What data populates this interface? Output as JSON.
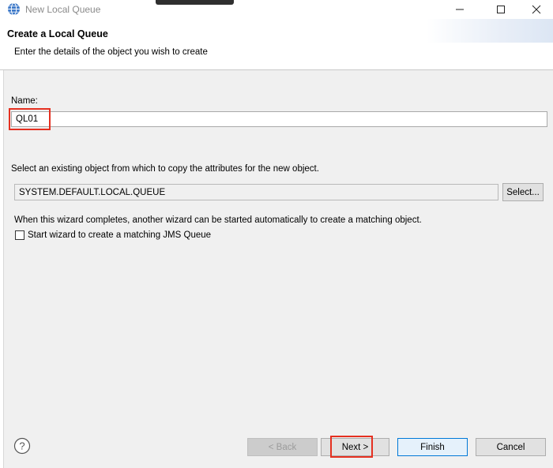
{
  "window": {
    "title": "New Local Queue",
    "icons": {
      "app": "globe-icon",
      "minimize": "minimize-icon",
      "maximize": "maximize-icon",
      "close": "close-icon"
    }
  },
  "header": {
    "title": "Create a Local Queue",
    "description": "Enter the details of the object you wish to create"
  },
  "form": {
    "name_label": "Name:",
    "name_value": "QL01",
    "copy_label": "Select an existing object from which to copy the attributes for the new object.",
    "copy_value": "SYSTEM.DEFAULT.LOCAL.QUEUE",
    "select_label": "Select...",
    "wizard_note": "When this wizard completes, another wizard can be started automatically to create a matching object.",
    "wizard_checkbox_label": "Start wizard to create a matching JMS Queue",
    "wizard_checkbox_checked": false
  },
  "footer": {
    "help_icon": "help-icon",
    "back_label": "< Back",
    "next_label": "Next >",
    "finish_label": "Finish",
    "cancel_label": "Cancel"
  },
  "colors": {
    "highlight": "#e53020",
    "primary_border": "#0078d7"
  }
}
